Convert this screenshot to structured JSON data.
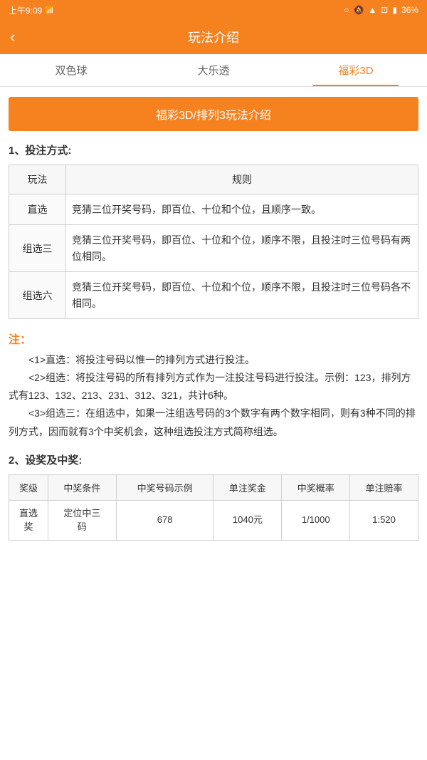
{
  "status_bar": {
    "time": "上午9:09",
    "battery": "36%"
  },
  "header": {
    "back_icon": "‹",
    "title": "玩法介绍"
  },
  "tabs": [
    {
      "label": "双色球",
      "active": false
    },
    {
      "label": "大乐透",
      "active": false
    },
    {
      "label": "福彩3D",
      "active": true
    }
  ],
  "banner": {
    "text": "福彩3D/排列3玩法介绍"
  },
  "section1": {
    "title": "1、投注方式:",
    "table": {
      "headers": [
        "玩法",
        "规则"
      ],
      "rows": [
        {
          "name": "直选",
          "rule": "竞猜三位开奖号码，即百位、十位和个位，且顺序一致。"
        },
        {
          "name": "组选三",
          "rule": "竞猜三位开奖号码，即百位、十位和个位，顺序不限，且投注时三位号码有两位相同。"
        },
        {
          "name": "组选六",
          "rule": "竞猜三位开奖号码，即百位、十位和个位，顺序不限，且投注时三位号码各不相同。"
        }
      ]
    }
  },
  "notes": {
    "label": "注：",
    "items": [
      "<1>直选：将投注号码以惟一的排列方式进行投注。",
      "<2>组选：将投注号码的所有排列方式作为一注投注号码进行投注。示例：123，排列方式有123、132、213、231、312、321，共计6种。",
      "<3>组选三：在组选中，如果一注组选号码的3个数字有两个数字相同，则有3种不同的排列方式，因而就有3个中奖机会，这种组选投注方式简称组选。"
    ]
  },
  "section2": {
    "title": "2、设奖及中奖:",
    "prize_table": {
      "headers": [
        "奖级",
        "中奖条件",
        "中奖号码示例",
        "单注奖金",
        "中奖概率",
        "单注赔率"
      ],
      "rows": [
        {
          "prize_level": "直选奖",
          "condition": "定位中三码",
          "example": "678",
          "single_prize": "1040元",
          "odds": "1/1000",
          "payout": "1:520"
        }
      ]
    }
  }
}
